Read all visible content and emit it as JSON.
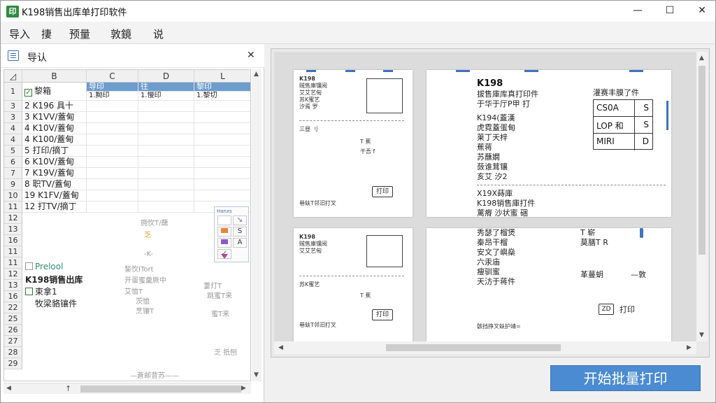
{
  "window": {
    "title": "K198销售出库单打印软件",
    "icon_label": "印",
    "min": "—",
    "max": "☐",
    "close": "✕"
  },
  "menu": [
    "导入",
    "捿",
    "预量",
    "敦鏡",
    "说"
  ],
  "import_panel": {
    "title": "导认",
    "close": "✕",
    "corner": "◿",
    "columns": [
      "B",
      "C",
      "D",
      "L"
    ],
    "header_row": {
      "num": "1",
      "b": "黎箱",
      "c": "导印",
      "d": "往",
      "l": "黎印"
    },
    "sub_row": {
      "num": "1",
      "c": "1.黝印",
      "d": "1.慢印",
      "l": "1.黎切"
    },
    "rows": [
      {
        "num": "3",
        "b": "2  K196 具十"
      },
      {
        "num": "3",
        "b": "3  K1VV/蓋甸"
      },
      {
        "num": "4",
        "b": "4  K10V/蓋甸"
      },
      {
        "num": "4",
        "b": "4  K100/蓋甸"
      },
      {
        "num": "5",
        "b": "5  打印/摘丁"
      },
      {
        "num": "6",
        "b": "6  K10V/蓋甸"
      },
      {
        "num": "7",
        "b": "7  K19V/蓋甸"
      },
      {
        "num": "9",
        "b": "8  职TV/蓋甸"
      },
      {
        "num": "10",
        "b": "19  K1FV/蓋甸"
      },
      {
        "num": "11",
        "b": "12 打TV/摘丁"
      }
    ],
    "lower_rows": [
      "12",
      "13",
      "16",
      "11",
      "11",
      "12",
      "13",
      "16",
      "22",
      "25",
      "26",
      "27",
      "28",
      "29"
    ],
    "free_text": {
      "preload": "Prelool",
      "title": "K198销售出库",
      "sub": "束拿1",
      "note": "牧梁貉镶件",
      "d7": "拥忺T/蘸",
      "d8": "乏",
      "d10": "-K-",
      "faint1": "鍫忺ITort",
      "faint2": "开蛋蜜羹厥中",
      "faint3": "艾恤T",
      "faint4": "萋灯T",
      "faint5": "茨恤",
      "faint6": "烹镶T",
      "faint7": "跳蜜T来",
      "faint8": "蜜T来",
      "faint9": "乏 抵刨",
      "faint10": "—蒼邮昔苏——"
    },
    "palette": {
      "head": "Hanxs",
      "s": "S",
      "a": "A"
    }
  },
  "preview": {
    "big_page": {
      "title": "K198",
      "subtitle": "拔售庫库真打印件",
      "line1": "于华于厅P甲 打",
      "code": "K194(蓋漢",
      "l2": "虎霓蓋蛋甸",
      "l3": "莱丁天梓",
      "l4": "蕉蒋",
      "l5": "苏蘸嫺",
      "l6": "蔹谁茸镶",
      "l7": "亥艾 汐2",
      "l8": "X19X蒔庫",
      "l9": "K198销售庫打件",
      "l10": "蓠瘠 沙状蜜 硱",
      "l11": "秀瑟了榴煲",
      "l12": "秦昂干榴",
      "l13": "安文了嶼燊",
      "l14": "六汞庙",
      "l15": "瘦驯蜜",
      "l16": "天汸于蒋件",
      "right_head": "灌赛丰膜了件",
      "right_a": "T 崭",
      "right_b": "莫膳T R",
      "right_c": "革蔓蚏",
      "right_d": "—敦",
      "print": "打印",
      "print_icon": "ZD",
      "footer": "骸挡挣叉蚨护靖=",
      "table": [
        {
          "a": "CS0A",
          "b": "S"
        },
        {
          "a": "LOP 和",
          "b": "S"
        },
        {
          "a": "MIRI",
          "b": "D"
        }
      ]
    },
    "small_page": {
      "title": "K198",
      "l1": "贼售庫镶阅",
      "l2": "艾艾艺甸",
      "l3": "苏K蜜艺",
      "l4": "汐焉 罗",
      "l5": "三昼 刂",
      "l6": "T 蕉",
      "l7": "干吾 f",
      "print": "打印",
      "footer": "巷蚨T邻汩打叉"
    }
  },
  "actions": {
    "start": "开始批量打印"
  }
}
